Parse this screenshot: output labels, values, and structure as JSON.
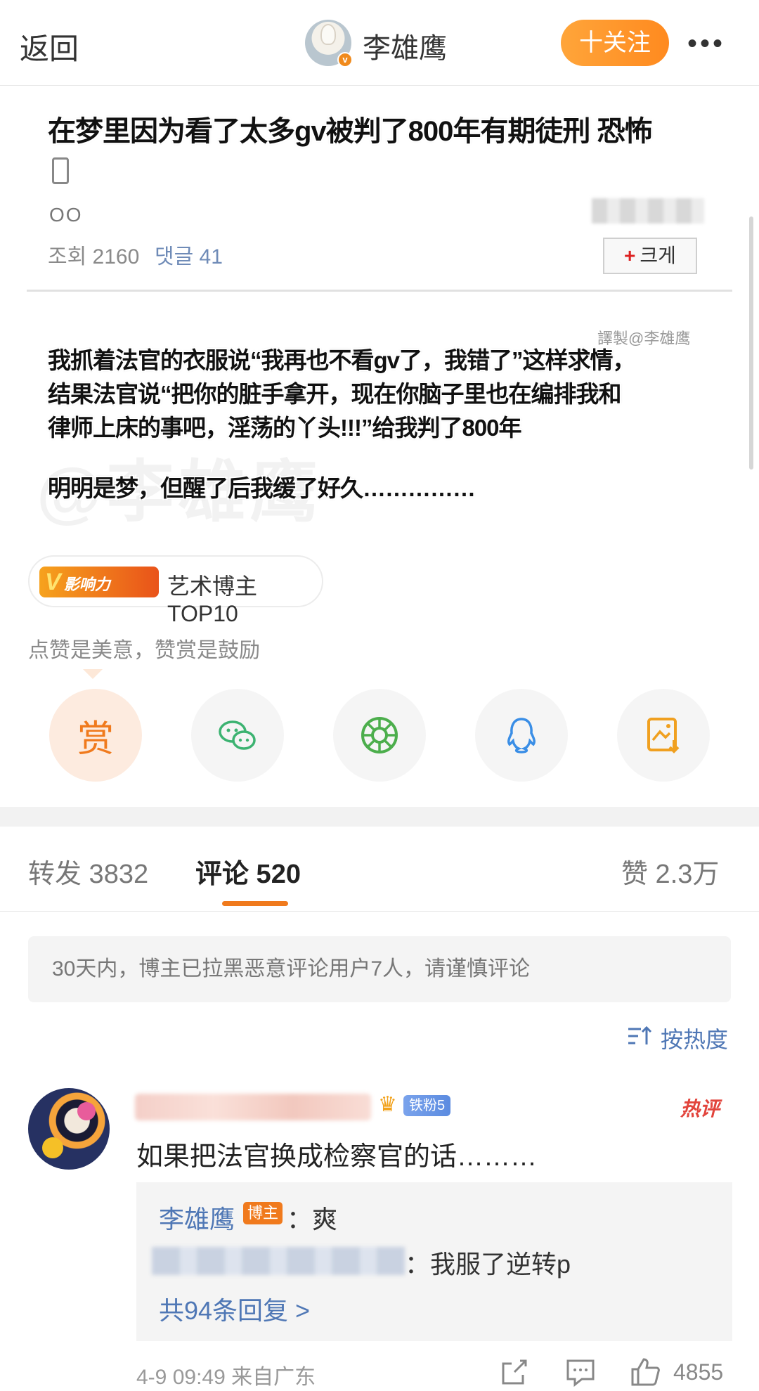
{
  "nav": {
    "back_label": "返回",
    "username": "李雄鹰",
    "follow_label": "十关注",
    "more_label": "•••"
  },
  "post": {
    "title": "在梦里因为看了太多gv被判了800年有期徒刑 恐怖",
    "oo_label": "OO",
    "views_label": "조회 2160",
    "comments_label": "댓글 41",
    "bigger_label": "크게",
    "watermark_small": "譯製@李雄鹰",
    "watermark_big": "@李雄鹰",
    "paragraph_lines": [
      "我抓着法官的衣服说“我再也不看gv了，我错了”这样求情，",
      "结果法官说“把你的脏手拿开，现在你脑子里也在编排我和",
      "律师上床的事吧，淫荡的丫头!!!”给我判了800年"
    ],
    "closing_line": "明明是梦，但醒了后我缓了好久……………"
  },
  "influence": {
    "badge_text": "影响力",
    "label": "艺术博主TOP10"
  },
  "reward_note": "点赞是美意，赞赏是鼓励",
  "share": {
    "reward_label": "赏",
    "icons": [
      "wechat-icon",
      "moments-icon",
      "qq-icon",
      "save-image-icon"
    ]
  },
  "tabs": {
    "repost": "转发 3832",
    "comments": "评论 520",
    "likes": "赞 2.3万"
  },
  "notice": "30天内，博主已拉黑恶意评论用户7人，请谨慎评论",
  "sort_label": "按热度",
  "comment": {
    "fan_badge": "铁粉5",
    "hot_tag": "热评",
    "text": "如果把法官换成检察官的话………",
    "reply1_name": "李雄鹰",
    "reply1_badge": "博主",
    "reply1_text": "：爽",
    "reply2_text": "：我服了逆转p",
    "more_replies": "共94条回复 >",
    "meta": "4-9 09:49 来自广东",
    "like_count": "4855"
  },
  "colors": {
    "accent_orange": "#f07a1d",
    "link_blue": "#4f77b5",
    "hot_red": "#e2443c"
  }
}
